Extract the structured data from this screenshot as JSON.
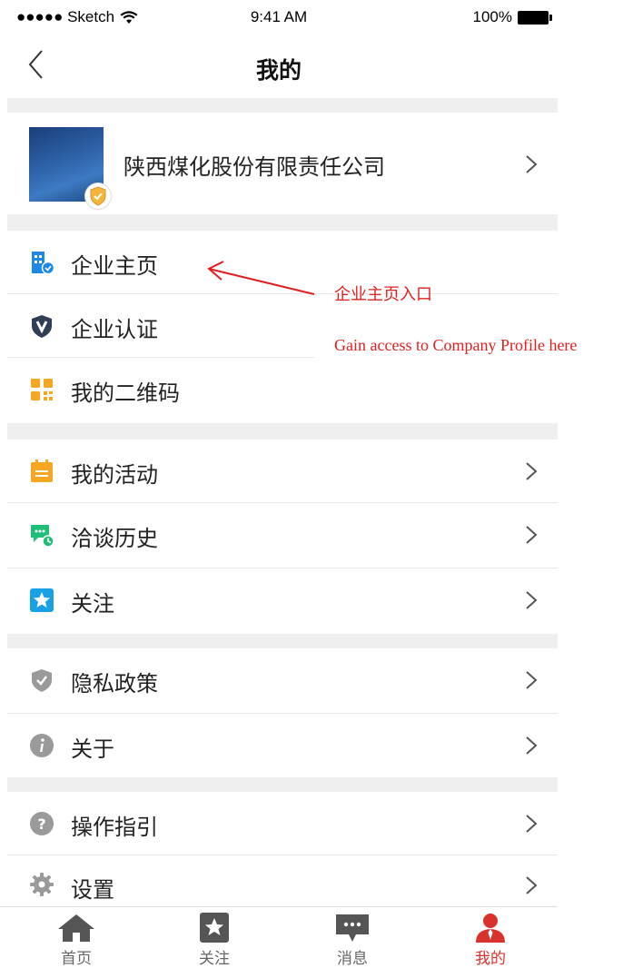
{
  "status_bar": {
    "carrier": "●●●●● Sketch",
    "time": "9:41 AM",
    "battery": "100%"
  },
  "nav": {
    "title": "我的",
    "back_icon": "chevron-left-icon"
  },
  "profile": {
    "company_name": "陕西煤化股份有限责任公司",
    "badge_icon": "shield-badge-icon"
  },
  "menu": {
    "group1": [
      {
        "label": "企业主页",
        "icon": "building-icon",
        "color": "#1e88e5"
      },
      {
        "label": "企业认证",
        "icon": "v-badge-icon",
        "color": "#2f3d55"
      },
      {
        "label": "我的二维码",
        "icon": "qrcode-icon",
        "color": "#f5a623"
      }
    ],
    "group2": [
      {
        "label": "我的活动",
        "icon": "calendar-icon",
        "color": "#f5a623"
      },
      {
        "label": "洽谈历史",
        "icon": "chat-history-icon",
        "color": "#1fbf7a"
      },
      {
        "label": "关注",
        "icon": "star-icon",
        "color": "#1aa0e6"
      }
    ],
    "group3": [
      {
        "label": "隐私政策",
        "icon": "shield-check-icon",
        "color": "#9a9a9a"
      },
      {
        "label": "关于",
        "icon": "info-icon",
        "color": "#9a9a9a"
      }
    ],
    "group4": [
      {
        "label": "操作指引",
        "icon": "help-icon",
        "color": "#9a9a9a"
      },
      {
        "label": "设置",
        "icon": "gear-icon",
        "color": "#9a9a9a"
      }
    ]
  },
  "annotation": {
    "cn": "企业主页入口",
    "en": "Gain access to Company Profile here",
    "color": "#e02020"
  },
  "tabbar": {
    "items": [
      {
        "label": "首页",
        "icon": "home-icon"
      },
      {
        "label": "关注",
        "icon": "star-square-icon"
      },
      {
        "label": "消息",
        "icon": "message-icon"
      },
      {
        "label": "我的",
        "icon": "person-icon",
        "active": true
      }
    ],
    "active_color": "#d9312b"
  }
}
